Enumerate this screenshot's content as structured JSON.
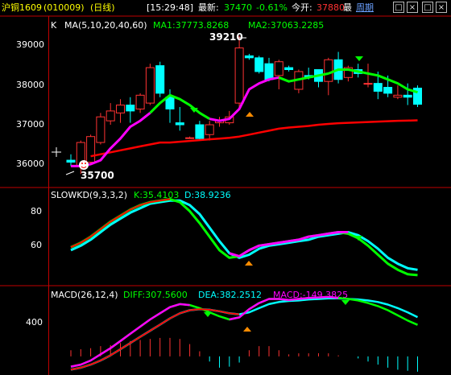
{
  "topbar": {
    "symbol": "沪铜1609",
    "code": "(010009)",
    "period": "(日线)",
    "time": "[15:29:48]",
    "latest_label": "最新:",
    "latest_value": "37470",
    "change_pct": "-0.61%",
    "open_label": "今开:",
    "open_value": "37880",
    "high_label": "最",
    "cycle_label": "周期",
    "buttons": [
      "□",
      "×",
      "□",
      "×"
    ]
  },
  "colors": {
    "up": "#ff3232",
    "down": "#00ffff",
    "ma_slow": "#ff0000",
    "ma_seg_a": "#ff00ff",
    "ma_seg_b": "#00ff00",
    "white": "#ffffff",
    "orange": "#ff8c00",
    "axis": "#c00000"
  },
  "main_panel": {
    "label_k": "K",
    "ma_label": "MA(5,10,20,40,60)",
    "ma1_label": "MA1:37773.8268",
    "ma2_label": "MA2:37063.2285",
    "high_annotation": "39210",
    "low_annotation": "35700",
    "yticks": [
      "39000",
      "38000",
      "37000",
      "36000"
    ]
  },
  "kd_panel": {
    "title": "SLOWKD(9,3,3,2)",
    "k_label": "K:35.4103",
    "d_label": "D:38.9236",
    "yticks": [
      "80",
      "60"
    ]
  },
  "macd_panel": {
    "title": "MACD(26,12,4)",
    "diff_label": "DIFF:307.5600",
    "dea_label": "DEA:382.2512",
    "macd_label": "MACD:-149.3825",
    "yticks": [
      "400"
    ]
  },
  "chart_data": [
    {
      "type": "candlestick",
      "title": "沪铜1609 (010009) 日线",
      "ylim": [
        35500,
        39300
      ],
      "candles": [
        {
          "o": 36050,
          "h": 36200,
          "l": 35900,
          "c": 36000
        },
        {
          "o": 35900,
          "h": 36550,
          "l": 35700,
          "c": 36500
        },
        {
          "o": 36000,
          "h": 36700,
          "l": 35980,
          "c": 36650
        },
        {
          "o": 36500,
          "h": 37250,
          "l": 36450,
          "c": 37150
        },
        {
          "o": 37050,
          "h": 37500,
          "l": 36950,
          "c": 37300
        },
        {
          "o": 37250,
          "h": 37600,
          "l": 37000,
          "c": 37450
        },
        {
          "o": 37450,
          "h": 37650,
          "l": 37000,
          "c": 37300
        },
        {
          "o": 37350,
          "h": 37750,
          "l": 37250,
          "c": 37700
        },
        {
          "o": 37500,
          "h": 38500,
          "l": 37450,
          "c": 38400
        },
        {
          "o": 38450,
          "h": 38550,
          "l": 37650,
          "c": 37750
        },
        {
          "o": 37650,
          "h": 37850,
          "l": 37000,
          "c": 37350
        },
        {
          "o": 37000,
          "h": 37400,
          "l": 36800,
          "c": 36950
        },
        {
          "o": 36600,
          "h": 36650,
          "l": 36600,
          "c": 36620
        },
        {
          "o": 36950,
          "h": 37050,
          "l": 36550,
          "c": 36600
        },
        {
          "o": 36700,
          "h": 37050,
          "l": 36550,
          "c": 36950
        },
        {
          "o": 37000,
          "h": 37150,
          "l": 36900,
          "c": 37050
        },
        {
          "o": 37000,
          "h": 37300,
          "l": 36950,
          "c": 37150
        },
        {
          "o": 37500,
          "h": 39210,
          "l": 37400,
          "c": 38900
        },
        {
          "o": 38700,
          "h": 38750,
          "l": 38600,
          "c": 38650
        },
        {
          "o": 38650,
          "h": 38700,
          "l": 38250,
          "c": 38300
        },
        {
          "o": 38500,
          "h": 38650,
          "l": 38050,
          "c": 38100
        },
        {
          "o": 38200,
          "h": 38600,
          "l": 37850,
          "c": 38550
        },
        {
          "o": 38400,
          "h": 38450,
          "l": 38300,
          "c": 38350
        },
        {
          "o": 37850,
          "h": 38350,
          "l": 37750,
          "c": 38300
        },
        {
          "o": 38200,
          "h": 38400,
          "l": 38100,
          "c": 38150
        },
        {
          "o": 38350,
          "h": 38350,
          "l": 37900,
          "c": 38050
        },
        {
          "o": 38050,
          "h": 38650,
          "l": 37700,
          "c": 38600
        },
        {
          "o": 38600,
          "h": 38800,
          "l": 38000,
          "c": 38100
        },
        {
          "o": 38150,
          "h": 38450,
          "l": 38050,
          "c": 38400
        },
        {
          "o": 38350,
          "h": 38500,
          "l": 38150,
          "c": 38250
        },
        {
          "o": 38000,
          "h": 38500,
          "l": 37900,
          "c": 38000
        },
        {
          "o": 38000,
          "h": 38300,
          "l": 37600,
          "c": 37800
        },
        {
          "o": 37900,
          "h": 38200,
          "l": 37650,
          "c": 37750
        },
        {
          "o": 37650,
          "h": 37950,
          "l": 37600,
          "c": 37700
        },
        {
          "o": 37700,
          "h": 38000,
          "l": 37450,
          "c": 37650
        },
        {
          "o": 37880,
          "h": 37950,
          "l": 37400,
          "c": 37470
        }
      ],
      "ma_fast": [
        35900,
        35900,
        35950,
        36050,
        36350,
        36600,
        36900,
        37050,
        37250,
        37500,
        37700,
        37600,
        37450,
        37250,
        37100,
        37050,
        37100,
        37350,
        37850,
        38000,
        38100,
        38150,
        38050,
        38100,
        38150,
        38200,
        38250,
        38350,
        38350,
        38300,
        38250,
        38200,
        38100,
        38000,
        37850,
        37774
      ],
      "ma_fast_segments": [
        {
          "from": 0,
          "to": 8,
          "color": "ma_seg_a"
        },
        {
          "from": 8,
          "to": 14,
          "color": "ma_seg_b"
        },
        {
          "from": 14,
          "to": 21,
          "color": "ma_seg_a"
        },
        {
          "from": 21,
          "to": 26,
          "color": "ma_seg_b"
        },
        {
          "from": 26,
          "to": 35,
          "color": "ma_seg_b"
        }
      ],
      "ma_slow": [
        36050,
        36100,
        36150,
        36200,
        36250,
        36300,
        36350,
        36400,
        36450,
        36500,
        36500,
        36520,
        36540,
        36560,
        36580,
        36600,
        36620,
        36650,
        36700,
        36750,
        36800,
        36850,
        36880,
        36900,
        36920,
        36950,
        36970,
        36990,
        37000,
        37010,
        37020,
        37030,
        37040,
        37050,
        37055,
        37063
      ],
      "ma_slow_start": 2
    },
    {
      "type": "line",
      "title": "SLOWKD(9,3,3,2)",
      "ylim": [
        30,
        90
      ],
      "series": [
        {
          "name": "K",
          "values": [
            54,
            57,
            61,
            66,
            71,
            75,
            79,
            82,
            84,
            85,
            86,
            84,
            78,
            70,
            61,
            52,
            47,
            48,
            52,
            55,
            56,
            57,
            58,
            59,
            61,
            62,
            63,
            64,
            63,
            60,
            55,
            49,
            43,
            39,
            36,
            35.4103
          ]
        },
        {
          "name": "D",
          "values": [
            52,
            55,
            59,
            64,
            69,
            73,
            77,
            80,
            83,
            84,
            85,
            85,
            82,
            76,
            67,
            58,
            50,
            47,
            49,
            53,
            55,
            56,
            57,
            58,
            59,
            61,
            62,
            63,
            64,
            62,
            58,
            53,
            47,
            43,
            40,
            38.9236
          ]
        }
      ]
    },
    {
      "type": "line",
      "title": "MACD(26,12,4)",
      "ylim": [
        -150,
        650
      ],
      "series": [
        {
          "name": "DIFF",
          "values": [
            -100,
            -80,
            -40,
            20,
            80,
            150,
            220,
            290,
            360,
            420,
            480,
            510,
            500,
            470,
            430,
            390,
            360,
            380,
            460,
            520,
            560,
            560,
            550,
            560,
            570,
            575,
            580,
            570,
            560,
            545,
            520,
            490,
            450,
            400,
            350,
            307.56
          ]
        },
        {
          "name": "DEA",
          "values": [
            -130,
            -110,
            -80,
            -40,
            10,
            70,
            130,
            190,
            250,
            310,
            370,
            420,
            450,
            460,
            455,
            440,
            420,
            410,
            430,
            470,
            510,
            530,
            540,
            545,
            555,
            560,
            565,
            565,
            560,
            555,
            545,
            530,
            505,
            470,
            430,
            382.2512
          ]
        },
        {
          "name": "MACD",
          "values": [
            60,
            70,
            80,
            100,
            110,
            130,
            150,
            160,
            170,
            180,
            180,
            170,
            120,
            50,
            -50,
            -110,
            -100,
            -60,
            60,
            100,
            100,
            60,
            20,
            30,
            30,
            30,
            30,
            10,
            0,
            -20,
            -50,
            -80,
            -110,
            -130,
            -140,
            -149.3825
          ]
        }
      ]
    }
  ]
}
